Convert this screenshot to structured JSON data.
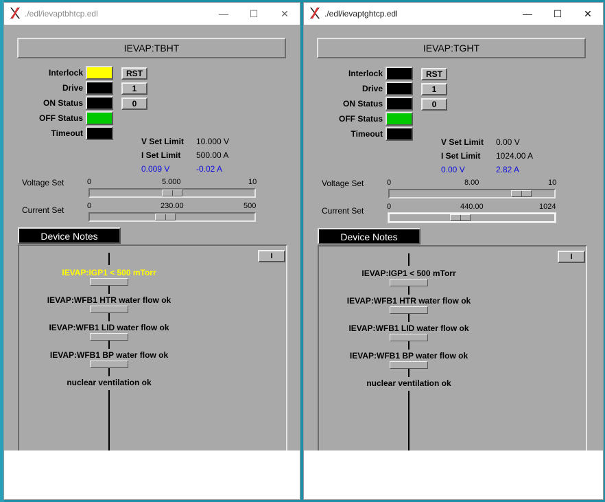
{
  "windows": [
    {
      "title": "./edl/ievaptbhtcp.edl",
      "window_controls": {
        "minimize": "—",
        "maximize": "☐",
        "close": "✕"
      },
      "device_name": "IEVAP:TBHT",
      "status": {
        "interlock": {
          "label": "Interlock",
          "color": "#ffff00"
        },
        "drive": {
          "label": "Drive",
          "color": "#000000"
        },
        "on_status": {
          "label": "ON Status",
          "color": "#000000"
        },
        "off_status": {
          "label": "OFF Status",
          "color": "#00c800"
        },
        "timeout": {
          "label": "Timeout",
          "color": "#000000"
        }
      },
      "buttons": {
        "rst": "RST",
        "one": "1",
        "zero": "0"
      },
      "limits": {
        "v_label": "V Set Limit",
        "v_value": "10.000 V",
        "i_label": "I Set Limit",
        "i_value": "500.00 A",
        "v_readback": "0.009 V",
        "i_readback": "-0.02 A"
      },
      "voltage_set": {
        "label": "Voltage Set",
        "min": "0",
        "max": "10",
        "value_text": "5.000",
        "value": 5.0,
        "min_value": 0,
        "max_value": 10
      },
      "current_set": {
        "label": "Current Set",
        "min": "0",
        "max": "500",
        "value_text": "230.00",
        "value": 230.0,
        "min_value": 0,
        "max_value": 500
      },
      "device_notes": "Device Notes",
      "panel_button": "I",
      "interlocks": [
        {
          "text": "IEVAP:IGP1 < 500 mTorr",
          "color": "#ffff00"
        },
        {
          "text": "IEVAP:WFB1 HTR water flow ok",
          "color": "#000000"
        },
        {
          "text": "IEVAP:WFB1 LID water flow ok",
          "color": "#000000"
        },
        {
          "text": "IEVAP:WFB1 BP water flow ok",
          "color": "#000000"
        },
        {
          "text": "nuclear ventilation ok",
          "color": "#000000"
        }
      ]
    },
    {
      "title": "./edl/ievaptghtcp.edl",
      "window_controls": {
        "minimize": "—",
        "maximize": "☐",
        "close": "✕"
      },
      "device_name": "IEVAP:TGHT",
      "status": {
        "interlock": {
          "label": "Interlock",
          "color": "#000000"
        },
        "drive": {
          "label": "Drive",
          "color": "#000000"
        },
        "on_status": {
          "label": "ON Status",
          "color": "#000000"
        },
        "off_status": {
          "label": "OFF Status",
          "color": "#00c800"
        },
        "timeout": {
          "label": "Timeout",
          "color": "#000000"
        }
      },
      "buttons": {
        "rst": "RST",
        "one": "1",
        "zero": "0"
      },
      "limits": {
        "v_label": "V Set Limit",
        "v_value": "0.00 V",
        "i_label": "I Set Limit",
        "i_value": "1024.00 A",
        "v_readback": "0.00 V",
        "i_readback": "2.82 A"
      },
      "voltage_set": {
        "label": "Voltage Set",
        "min": "0",
        "max": "10",
        "value_text": "8.00",
        "value": 8.0,
        "min_value": 0,
        "max_value": 10
      },
      "current_set": {
        "label": "Current Set",
        "min": "0",
        "max": "1024",
        "value_text": "440.00",
        "value": 440.0,
        "min_value": 0,
        "max_value": 1024
      },
      "device_notes": "Device Notes",
      "panel_button": "I",
      "interlocks": [
        {
          "text": "IEVAP:IGP1 < 500 mTorr",
          "color": "#000000"
        },
        {
          "text": "IEVAP:WFB1 HTR water flow ok",
          "color": "#000000"
        },
        {
          "text": "IEVAP:WFB1 LID water flow ok",
          "color": "#000000"
        },
        {
          "text": "IEVAP:WFB1 BP water flow ok",
          "color": "#000000"
        },
        {
          "text": "nuclear ventilation ok",
          "color": "#000000"
        }
      ]
    }
  ]
}
